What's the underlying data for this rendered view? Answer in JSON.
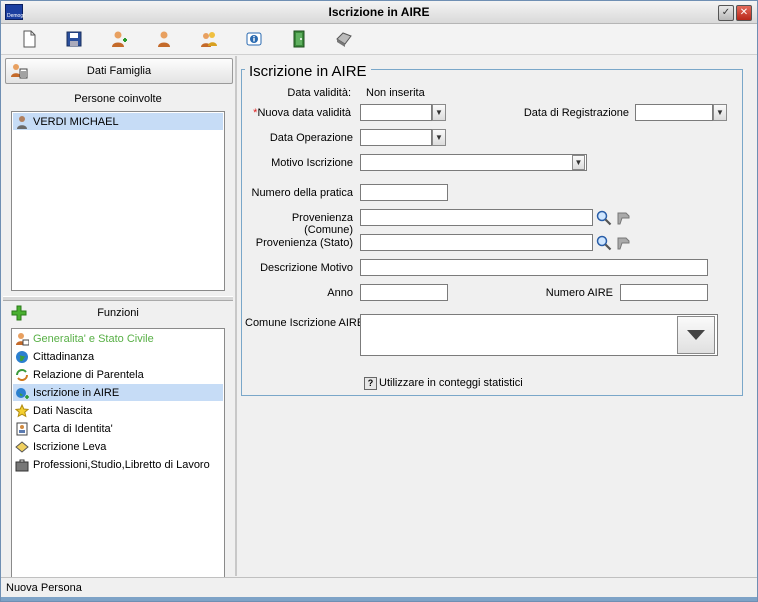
{
  "window": {
    "title": "Iscrizione in AIRE",
    "app_icon_text": "Demogr"
  },
  "toolbar": {
    "items": [
      "new-doc",
      "save",
      "add-person",
      "person",
      "people",
      "info",
      "exit-door",
      "print"
    ]
  },
  "left": {
    "famiglia_button": "Dati Famiglia",
    "persone_label": "Persone coinvolte",
    "persone": [
      {
        "label": "VERDI MICHAEL",
        "selected": true
      }
    ],
    "funzioni_label": "Funzioni",
    "funzioni": [
      {
        "label": "Generalita' e Stato Civile",
        "color": "#58b046",
        "icon": "person-card-icon"
      },
      {
        "label": "Cittadinanza",
        "icon": "globe-icon"
      },
      {
        "label": "Relazione di Parentela",
        "icon": "family-icon"
      },
      {
        "label": "Iscrizione in AIRE",
        "icon": "globe-plus-icon",
        "selected": true
      },
      {
        "label": "Dati Nascita",
        "icon": "star-icon"
      },
      {
        "label": "Carta di Identita'",
        "icon": "id-card-icon"
      },
      {
        "label": "Iscrizione Leva",
        "icon": "ticket-icon"
      },
      {
        "label": "Professioni,Studio,Libretto di Lavoro",
        "icon": "briefcase-icon"
      }
    ]
  },
  "form": {
    "legend": "Iscrizione in AIRE",
    "data_validita_label": "Data validità:",
    "data_validita_value": "Non inserita",
    "required_mark": "*",
    "nuova_data_label": "Nuova data validità",
    "nuova_data_value": "",
    "data_registrazione_label": "Data di Registrazione",
    "data_registrazione_value": "",
    "data_operazione_label": "Data Operazione",
    "data_operazione_value": "",
    "motivo_label": "Motivo Iscrizione",
    "motivo_value": "",
    "numero_pratica_label": "Numero della pratica",
    "numero_pratica_value": "",
    "prov_comune_label": "Provenienza (Comune)",
    "prov_comune_value": "",
    "prov_stato_label": "Provenienza (Stato)",
    "prov_stato_value": "",
    "descrizione_label": "Descrizione Motivo",
    "descrizione_value": "",
    "anno_label": "Anno",
    "anno_value": "",
    "numero_aire_label": "Numero AIRE",
    "numero_aire_value": "",
    "comune_iscrizione_label": "Comune Iscrizione AIRE",
    "comune_iscrizione_value": "",
    "statistici_checkbox_mark": "?",
    "statistici_label": "Utilizzare in conteggi statistici"
  },
  "status": {
    "text": "Nuova Persona"
  }
}
